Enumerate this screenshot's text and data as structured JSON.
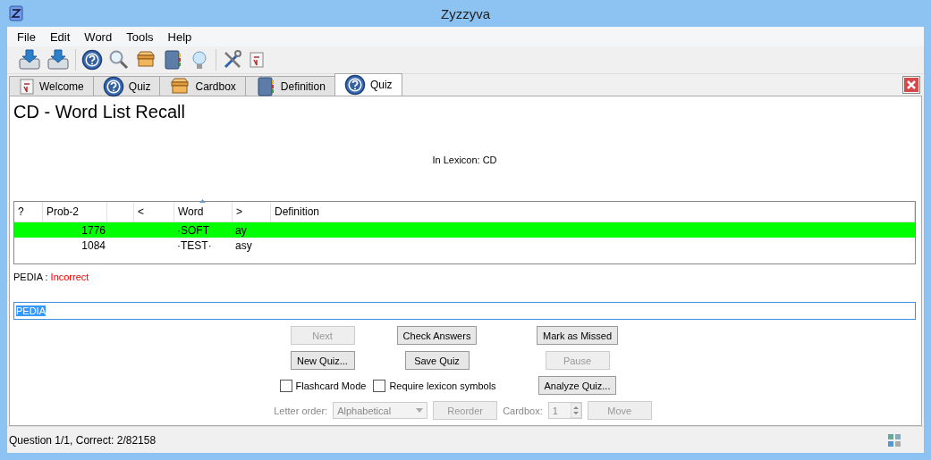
{
  "window": {
    "title": "Zyzzyva"
  },
  "menu": [
    "File",
    "Edit",
    "Word",
    "Tools",
    "Help"
  ],
  "tabs": [
    {
      "label": "Welcome",
      "kind": "welcome",
      "selected": false
    },
    {
      "label": "Quiz",
      "kind": "quiz",
      "selected": false
    },
    {
      "label": "Cardbox",
      "kind": "cardbox",
      "selected": false
    },
    {
      "label": "Definition",
      "kind": "definition",
      "selected": false
    },
    {
      "label": "Quiz",
      "kind": "quiz",
      "selected": true
    }
  ],
  "quiz": {
    "title": "CD - Word List Recall",
    "lexicon": "In Lexicon: CD",
    "table": {
      "columns": [
        {
          "label": "?",
          "sorted": false
        },
        {
          "label": "Prob-2",
          "sorted": false
        },
        {
          "label": "<",
          "sorted": false
        },
        {
          "label": "Word",
          "sorted": true
        },
        {
          "label": ">",
          "sorted": false
        },
        {
          "label": "Definition",
          "sorted": false
        }
      ],
      "rows": [
        {
          "selected": true,
          "prob": "1776",
          "word": "·SOFT",
          "after": "ay"
        },
        {
          "selected": false,
          "prob": "1084",
          "word": "·TEST·",
          "after": "asy"
        }
      ]
    },
    "result": {
      "answer": "PEDIA",
      "separator": " : ",
      "verdict": "Incorrect"
    },
    "answer": {
      "value": "PEDIA"
    },
    "buttons": [
      {
        "label": "Next",
        "disabled": true
      },
      {
        "label": "Check Answers",
        "disabled": false
      },
      {
        "label": "Mark as Missed",
        "disabled": false
      },
      {
        "label": "New Quiz...",
        "disabled": false
      },
      {
        "label": "Save Quiz",
        "disabled": false
      },
      {
        "label": "Pause",
        "disabled": true
      }
    ],
    "checkboxes": [
      {
        "label": "Flashcard Mode",
        "checked": false
      },
      {
        "label": "Require lexicon symbols",
        "checked": false
      }
    ],
    "analyze_button": {
      "label": "Analyze Quiz...",
      "disabled": false
    },
    "letter_order": {
      "label": "Letter order:",
      "value": "Alphabetical",
      "disabled": true
    },
    "reorder_button": {
      "label": "Reorder",
      "disabled": true
    },
    "cardbox": {
      "label": "Cardbox:",
      "value": "1",
      "disabled": true
    },
    "move_button": {
      "label": "Move",
      "disabled": true
    }
  },
  "status_bar": {
    "text": "Question 1/1, Correct: 2/82158"
  }
}
